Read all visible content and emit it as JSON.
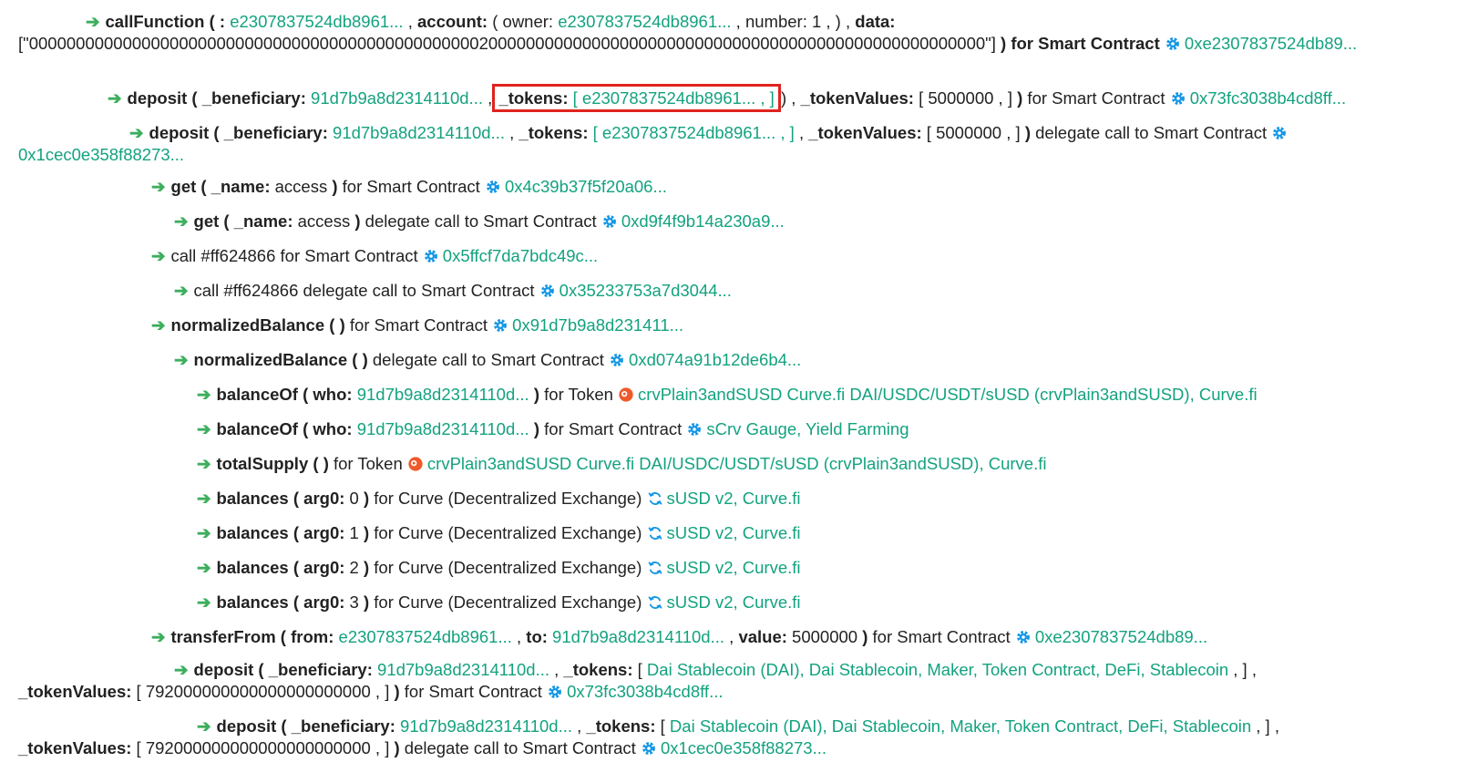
{
  "colors": {
    "arrow": "#3dae5e",
    "link": "#13a27f",
    "gear": "#1597e5",
    "token": "#ef5a2a",
    "curve": "#1597e5",
    "highlight": "#e0231e"
  },
  "rows": {
    "r1": {
      "fn": "callFunction",
      "p1": " ( ",
      "k1": ":",
      "v1": " e2307837524db8961...",
      "s1": " , ",
      "k2": "account:",
      "v2a": " ( owner: ",
      "v2b": "e2307837524db8961...",
      "v2c": " , number: 1 , ) , ",
      "k3": "data:",
      "data": "[\"000000000000000000000000000000000000000000000000200000000000000000000000000000000000000000000000000000\"]",
      "tail": " ) for Smart Contract ",
      "addr": "0xe2307837524db89..."
    },
    "r2": {
      "fn": "deposit",
      "open": " ( ",
      "k1": "_beneficiary:",
      "v1": " 91d7b9a8d2314110d...",
      "s1": " , ",
      "k2": "_tokens:",
      "v2": " [ e2307837524db8961... , ]",
      "s2": " ) , ",
      "k3": "_tokenValues:",
      "v3": " [ 5000000 , ] ",
      "close": ")",
      "tail": " for Smart Contract ",
      "addr": "0x73fc3038b4cd8ff..."
    },
    "r3": {
      "fn": "deposit",
      "open": " ( ",
      "k1": "_beneficiary:",
      "v1": " 91d7b9a8d2314110d...",
      "s1": " , ",
      "k2": "_tokens:",
      "v2": " [ e2307837524db8961... , ]",
      "s2": " , ",
      "k3": "_tokenValues:",
      "v3": " [ 5000000 , ] ",
      "close": ")",
      "tail": " delegate call to Smart Contract ",
      "addr": "0x1cec0e358f88273..."
    },
    "r4": {
      "fn": "get",
      "open": " ( ",
      "k1": "_name:",
      "v1": " access ",
      "close": ")",
      "tail": " for Smart Contract ",
      "addr": "0x4c39b37f5f20a06..."
    },
    "r5": {
      "fn": "get",
      "open": " ( ",
      "k1": "_name:",
      "v1": " access ",
      "close": ")",
      "tail": " delegate call to Smart Contract ",
      "addr": "0xd9f4f9b14a230a9..."
    },
    "r6": {
      "text": "call #ff624866 for Smart Contract ",
      "addr": "0x5ffcf7da7bdc49c..."
    },
    "r7": {
      "text": "call #ff624866 delegate call to Smart Contract ",
      "addr": "0x35233753a7d3044..."
    },
    "r8": {
      "fn": "normalizedBalance",
      "paren": " ( )",
      "tail": " for Smart Contract ",
      "addr": "0x91d7b9a8d231411..."
    },
    "r9": {
      "fn": "normalizedBalance",
      "paren": " ( )",
      "tail": " delegate call to Smart Contract ",
      "addr": "0xd074a91b12de6b4..."
    },
    "r10": {
      "fn": "balanceOf",
      "open": " ( ",
      "k1": "who:",
      "v1": " 91d7b9a8d2314110d... ",
      "close": ")",
      "tail": " for Token ",
      "addr": "crvPlain3andSUSD Curve.fi DAI/USDC/USDT/sUSD (crvPlain3andSUSD), Curve.fi"
    },
    "r11": {
      "fn": "balanceOf",
      "open": " ( ",
      "k1": "who:",
      "v1": " 91d7b9a8d2314110d... ",
      "close": ")",
      "tail": " for Smart Contract ",
      "addr": "sCrv Gauge, Yield Farming"
    },
    "r12": {
      "fn": "totalSupply",
      "paren": " ( )",
      "tail": " for Token ",
      "addr": "crvPlain3andSUSD Curve.fi DAI/USDC/USDT/sUSD (crvPlain3andSUSD), Curve.fi"
    },
    "r13": {
      "fn": "balances",
      "open": " ( ",
      "k1": "arg0:",
      "v1": " 0 ",
      "close": ")",
      "tail": " for Curve (Decentralized Exchange) ",
      "addr": "sUSD v2, Curve.fi"
    },
    "r14": {
      "fn": "balances",
      "open": " ( ",
      "k1": "arg0:",
      "v1": " 1 ",
      "close": ")",
      "tail": " for Curve (Decentralized Exchange) ",
      "addr": "sUSD v2, Curve.fi"
    },
    "r15": {
      "fn": "balances",
      "open": " ( ",
      "k1": "arg0:",
      "v1": " 2 ",
      "close": ")",
      "tail": " for Curve (Decentralized Exchange) ",
      "addr": "sUSD v2, Curve.fi"
    },
    "r16": {
      "fn": "balances",
      "open": " ( ",
      "k1": "arg0:",
      "v1": " 3 ",
      "close": ")",
      "tail": " for Curve (Decentralized Exchange) ",
      "addr": "sUSD v2, Curve.fi"
    },
    "r17": {
      "fn": "transferFrom",
      "open": " ( ",
      "k1": "from:",
      "v1": " e2307837524db8961...",
      "s1": " , ",
      "k2": "to:",
      "v2": " 91d7b9a8d2314110d...",
      "s2": " , ",
      "k3": "value:",
      "v3": " 5000000 ",
      "close": ")",
      "tail": " for Smart Contract ",
      "addr": "0xe2307837524db89..."
    },
    "r18": {
      "fn": "deposit",
      "open": " ( ",
      "k1": "_beneficiary:",
      "v1": " 91d7b9a8d2314110d...",
      "s1": " , ",
      "k2": "_tokens:",
      "v2a": " [ ",
      "v2": "Dai Stablecoin (DAI), Dai Stablecoin, Maker, Token Contract, DeFi, Stablecoin",
      "v2b": " , ] , ",
      "k3": "_tokenValues:",
      "v3": " [ 792000000000000000000000 , ] ",
      "close": ")",
      "tail": " for Smart Contract ",
      "addr": "0x73fc3038b4cd8ff..."
    },
    "r19": {
      "fn": "deposit",
      "open": " ( ",
      "k1": "_beneficiary:",
      "v1": " 91d7b9a8d2314110d...",
      "s1": " , ",
      "k2": "_tokens:",
      "v2a": " [ ",
      "v2": "Dai Stablecoin (DAI), Dai Stablecoin, Maker, Token Contract, DeFi, Stablecoin",
      "v2b": " , ] , ",
      "k3": "_tokenValues:",
      "v3": " [ 792000000000000000000000 , ] ",
      "close": ")",
      "tail": " delegate call to Smart Contract ",
      "addr": "0x1cec0e358f88273..."
    }
  }
}
